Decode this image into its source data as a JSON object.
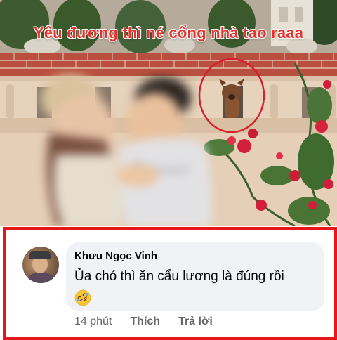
{
  "meme": {
    "caption": "Yêu đương thì né cổng nhà tao raaa",
    "highlight_color": "#d4202b"
  },
  "comment": {
    "author": "Khưu Ngọc Vinh",
    "text": "Ủa chó thì ăn cẩu lương là đúng rồi",
    "reaction_emoji": "rolling-on-floor-laughing",
    "time": "14 phút",
    "like_label": "Thích",
    "reply_label": "Trả lời",
    "border_color": "#e6161b"
  }
}
